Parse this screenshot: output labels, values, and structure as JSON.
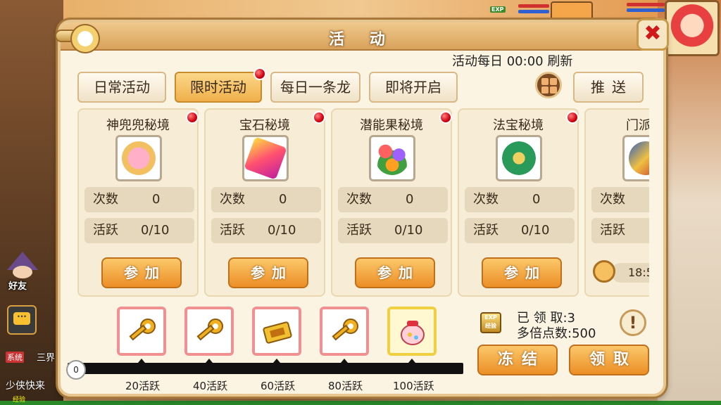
{
  "hud": {
    "exp_badge": "EXP"
  },
  "left": {
    "friend_label": "好友",
    "chat_icon_glyph": "···",
    "system_tag": "系统",
    "system_text": "三界",
    "chat_line": "少侠快来",
    "exp_label": "经验"
  },
  "panel": {
    "title": "活 动",
    "close_glyph": "✖",
    "refresh_text": "活动每日  00:00  刷新",
    "tabs": [
      {
        "label": "日常活动",
        "active": false,
        "reddot": false
      },
      {
        "label": "限时活动",
        "active": true,
        "reddot": true
      },
      {
        "label": "每日一条龙",
        "active": false,
        "reddot": false
      },
      {
        "label": "即将开启",
        "active": false,
        "reddot": false
      }
    ],
    "push_label": "推送"
  },
  "cards": [
    {
      "title": "神兜兜秘境",
      "icon": "pig-bag-icon",
      "count_label": "次数",
      "count_value": "0",
      "active_label": "活跃",
      "active_value": "0/10",
      "button": "参加",
      "reddot": true
    },
    {
      "title": "宝石秘境",
      "icon": "gem-icon",
      "count_label": "次数",
      "count_value": "0",
      "active_label": "活跃",
      "active_value": "0/10",
      "button": "参加",
      "reddot": true
    },
    {
      "title": "潜能果秘境",
      "icon": "fruit-icon",
      "count_label": "次数",
      "count_value": "0",
      "active_label": "活跃",
      "active_value": "0/10",
      "button": "参加",
      "reddot": true
    },
    {
      "title": "法宝秘境",
      "icon": "treasure-bag-icon",
      "count_label": "次数",
      "count_value": "0",
      "active_label": "活跃",
      "active_value": "0/10",
      "button": "参加",
      "reddot": true
    },
    {
      "title": "门派闯",
      "icon": "sect-icon",
      "count_label": "次数",
      "count_value": "",
      "active_label": "活跃",
      "active_value": "",
      "timer": "18:5",
      "reddot": false
    }
  ],
  "rewards": {
    "start_value": "0",
    "milestones": [
      {
        "label": "20活跃",
        "icon": "gold-key-icon"
      },
      {
        "label": "40活跃",
        "icon": "gold-key-icon"
      },
      {
        "label": "60活跃",
        "icon": "gold-ticket-icon"
      },
      {
        "label": "80活跃",
        "icon": "gold-key-icon"
      },
      {
        "label": "100活跃",
        "icon": "lucky-bag-icon"
      }
    ],
    "exp_badge_text": "EXP 经验",
    "claimed": "已 领 取:3",
    "multiplier": "多倍点数:500",
    "info_glyph": "!",
    "freeze_label": "冻结",
    "claim_label": "领取"
  }
}
